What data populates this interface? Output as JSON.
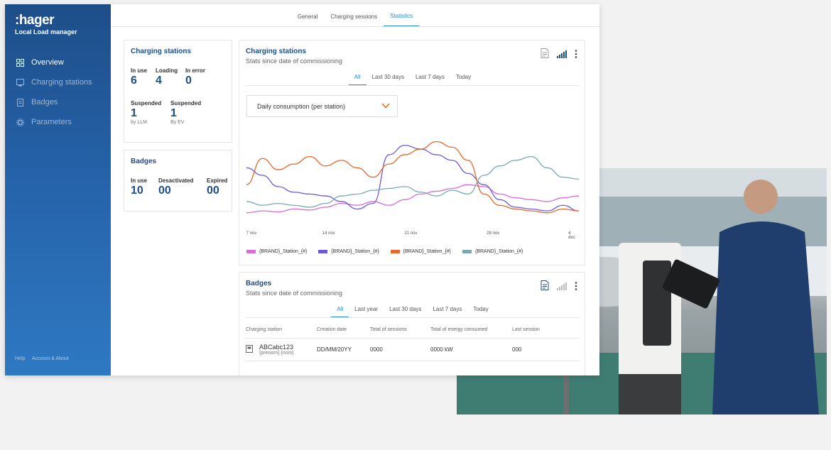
{
  "brand": {
    "logo": ":hager",
    "subtitle": "Local Load manager"
  },
  "sidebar": {
    "items": [
      {
        "label": "Overview",
        "icon": "grid-icon",
        "active": true
      },
      {
        "label": "Charging stations",
        "icon": "charging-station-icon"
      },
      {
        "label": "Badges",
        "icon": "badge-icon"
      },
      {
        "label": "Parameters",
        "icon": "gear-icon"
      }
    ],
    "footer": {
      "help": "Help",
      "account": "Account & About"
    }
  },
  "tabs": [
    "General",
    "Charging sessions",
    "Statistics"
  ],
  "stations_summary": {
    "title": "Charging stations",
    "in_use_label": "In use",
    "in_use": "6",
    "loading_label": "Loading",
    "loading": "4",
    "in_error_label": "In error",
    "in_error": "0",
    "suspended1_label": "Suspended",
    "suspended1": "1",
    "suspended1_sub": "by LLM",
    "suspended2_label": "Suspended",
    "suspended2": "1",
    "suspended2_sub": "By EV"
  },
  "badges_summary": {
    "title": "Badges",
    "in_use_label": "In use",
    "in_use": "10",
    "deactivated_label": "Desactivated",
    "deactivated": "00",
    "expired_label": "Expired",
    "expired": "00"
  },
  "stations_chart_card": {
    "title": "Charging stations",
    "subtitle": "Stats since date of commissioning",
    "tabs": [
      "All",
      "Last 30 days",
      "Last 7 days",
      "Today"
    ],
    "dropdown": "Daily consumption (per station)"
  },
  "chart_data": {
    "type": "line",
    "x_ticks": [
      "7 nov",
      "14 nov",
      "21 nov",
      "28 nov",
      "4 dec"
    ],
    "ylim": [
      0,
      100
    ],
    "series": [
      {
        "name": "{BRAND}_Station_{#}",
        "color": "#d96ad9",
        "values": [
          10,
          12,
          11,
          14,
          13,
          16,
          20,
          18,
          22,
          18,
          24,
          30,
          33,
          36,
          40,
          38,
          30,
          26,
          24,
          22,
          26,
          28
        ]
      },
      {
        "name": "{BRAND}_Station_{#}",
        "color": "#6a5cd8",
        "values": [
          58,
          50,
          38,
          32,
          30,
          28,
          22,
          14,
          20,
          72,
          82,
          78,
          72,
          66,
          52,
          40,
          24,
          16,
          14,
          12,
          18,
          12
        ]
      },
      {
        "name": "{BRAND}_Station_{#}",
        "color": "#e8672c",
        "values": [
          40,
          68,
          56,
          62,
          70,
          60,
          66,
          58,
          48,
          62,
          72,
          78,
          86,
          80,
          66,
          30,
          18,
          14,
          12,
          10,
          14,
          12
        ]
      },
      {
        "name": "{BRAND}_Station_{#}",
        "color": "#7aa9b3",
        "values": [
          22,
          18,
          20,
          18,
          16,
          20,
          28,
          30,
          34,
          36,
          38,
          32,
          28,
          34,
          30,
          50,
          60,
          66,
          70,
          58,
          48,
          46
        ]
      }
    ]
  },
  "badges_card": {
    "title": "Badges",
    "subtitle": "Stats since date of commissioning",
    "tabs": [
      "All",
      "Last year",
      "Last 30 days",
      "Last 7 days",
      "Today"
    ],
    "columns": [
      "Charging station",
      "Creation date",
      "Total of sessions",
      "Total of energy consumed",
      "Last session"
    ],
    "rows": [
      {
        "name": "ABCabc123",
        "sub": "{prenom} {nom}",
        "date": "DD/MM/20YY",
        "sessions": "0000",
        "energy": "0000 kW",
        "last": "000"
      }
    ]
  },
  "colors": {
    "accent": "#2b8ad1",
    "brand": "#1d4e89",
    "dropdown_arrow": "#e8672c"
  }
}
